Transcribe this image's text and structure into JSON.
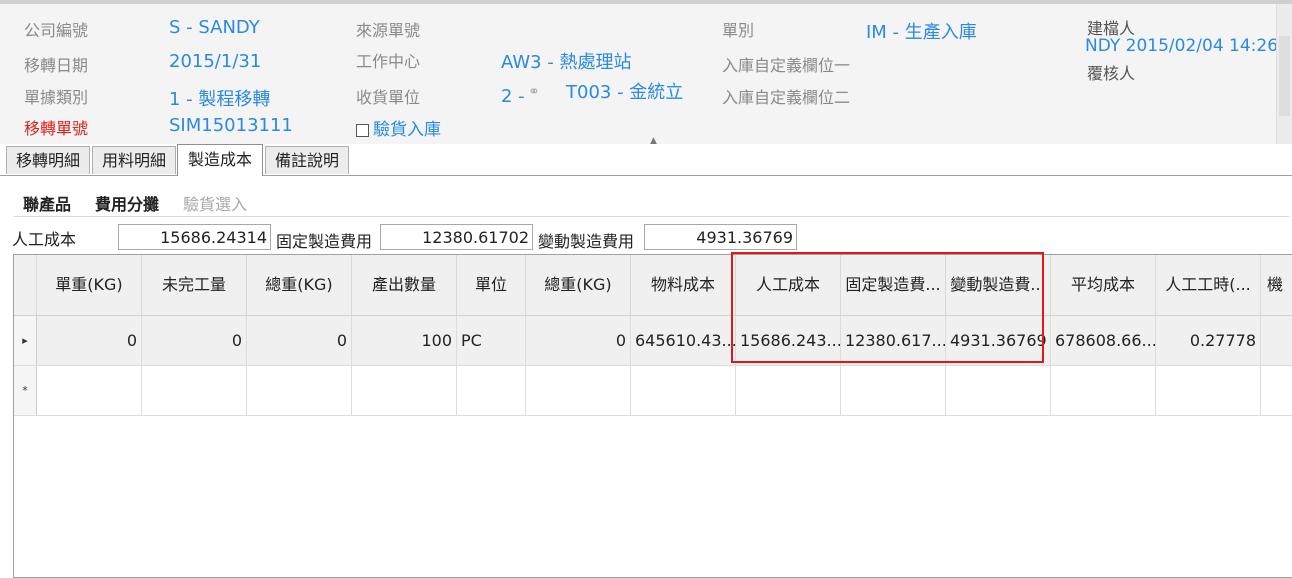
{
  "header": {
    "company_label": "公司編號",
    "company_value": "S - SANDY",
    "transfer_date_label": "移轉日期",
    "transfer_date_value": "2015/1/31",
    "doc_type_label": "單據類別",
    "doc_type_value": "1 - 製程移轉",
    "transfer_no_label": "移轉單號",
    "transfer_no_value": "SIM15013111",
    "source_doc_label": "來源單號",
    "work_center_label": "工作中心",
    "work_center_value": "AW3 - 熱處理站",
    "receiving_unit_label": "收貨單位",
    "receiving_unit_value": "2 - ",
    "receiving_unit_vendor": "T003 - 金統立",
    "inspection_label": "驗貨入庫",
    "doc_category_label": "單別",
    "doc_category_value": "IM - 生產入庫",
    "custom1_label": "入庫自定義欄位一",
    "custom2_label": "入庫自定義欄位二",
    "creator_label": "建檔人",
    "creator_value": "NDY 2015/02/04 14:26",
    "reviewer_label": "覆核人"
  },
  "tabs": [
    "移轉明細",
    "用料明細",
    "製造成本",
    "備註說明"
  ],
  "subtabs": [
    "聯產品",
    "費用分攤",
    "驗貨選入"
  ],
  "costs": {
    "labor_label": "人工成本",
    "labor_value": "15686.24314",
    "fixed_label": "固定製造費用",
    "fixed_value": "12380.61702",
    "variable_label": "變動製造費用",
    "variable_value": "4931.36769"
  },
  "grid": {
    "columns": [
      "單重(KG)",
      "未完工量",
      "總重(KG)",
      "產出數量",
      "單位",
      "總重(KG)",
      "物料成本",
      "人工成本",
      "固定製造費...",
      "變動製造費...",
      "平均成本",
      "人工工時(...",
      "機"
    ],
    "row": [
      "0",
      "0",
      "0",
      "100",
      "PC",
      "0",
      "645610.43...",
      "15686.243...",
      "12380.617...",
      "4931.36769",
      "678608.66...",
      "0.27778",
      ""
    ],
    "row_marker": "▸",
    "new_row_marker": "*"
  }
}
